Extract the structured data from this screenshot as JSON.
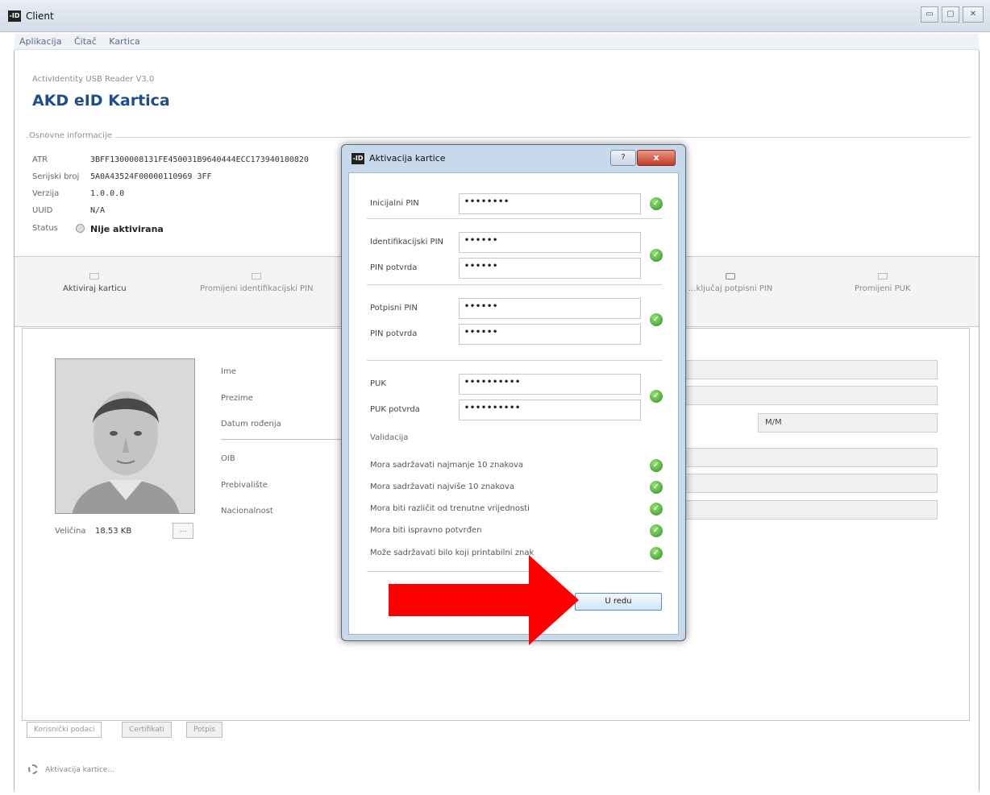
{
  "window": {
    "title": "Client",
    "logo_text": "-ID"
  },
  "window_controls": {
    "minimize": "▭",
    "maximize": "▢",
    "close": "✕"
  },
  "menu": [
    "Aplikacija",
    "Čitač",
    "Kartica"
  ],
  "reader": {
    "name": "ActivIdentity USB Reader V3.0",
    "card_name": "AKD eID Kartica"
  },
  "basic_info": {
    "label": "Osnovne informacije",
    "rows": [
      {
        "key": "ATR",
        "value": "3BFF1300008131FE450031B9640444ECC173940180820"
      },
      {
        "key": "Serijski broj",
        "value": "5A0A43524F00000110969 3FF"
      },
      {
        "key": "Verzija",
        "value": "1.0.0.0"
      },
      {
        "key": "UUID",
        "value": "N/A"
      },
      {
        "key": "Status",
        "value": "Nije aktivirana"
      }
    ]
  },
  "actions": [
    {
      "label": "Aktiviraj karticu"
    },
    {
      "label": "Promijeni identifikacijski PIN"
    },
    {
      "label": "...ključaj potpisni PIN"
    },
    {
      "label": "Promijeni PUK"
    }
  ],
  "person": {
    "size_label": "Veličina",
    "size_value": "18.53 KB",
    "browse": "...",
    "fields": [
      "Ime",
      "Prezime",
      "Datum rođenja",
      "OIB",
      "Prebivalište",
      "Nacionalnost"
    ],
    "gender_value": "M/M"
  },
  "bottom_tabs": [
    "Korisnički podaci",
    "Certifikati",
    "Potpis"
  ],
  "status_bar": "Aktivacija kartice...",
  "dialog": {
    "title": "Aktivacija kartice",
    "logo_text": "-ID",
    "help": "?",
    "close": "x",
    "initial_pin_label": "Inicijalni PIN",
    "initial_pin_value": "••••••••",
    "id_pin_label": "Identifikacijski PIN",
    "id_pin_value": "••••••",
    "id_pin_confirm_label": "PIN potvrda",
    "id_pin_confirm_value": "••••••",
    "sign_pin_label": "Potpisni PIN",
    "sign_pin_value": "••••••",
    "sign_pin_confirm_label": "PIN potvrda",
    "sign_pin_confirm_value": "••••••",
    "puk_label": "PUK",
    "puk_value": "••••••••••",
    "puk_confirm_label": "PUK potvrda",
    "puk_confirm_value": "••••••••••",
    "validation_label": "Validacija",
    "rules": [
      "Mora sadržavati najmanje 10 znakova",
      "Mora sadržavati najviše 10 znakova",
      "Mora biti različit od trenutne vrijednosti",
      "Mora biti ispravno potvrđen",
      "Može sadržavati bilo koji printabilni znak"
    ],
    "ok_button": "U redu",
    "check": "✓"
  },
  "colors": {
    "accent": "#1f4e8c",
    "arrow": "#ff0000",
    "valid": "#2f8e1c"
  }
}
